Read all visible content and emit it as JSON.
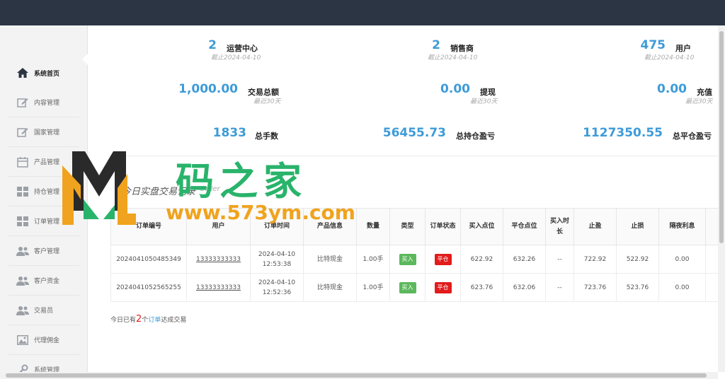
{
  "sidebar": {
    "items": [
      {
        "label": "系统首页",
        "icon": "home-icon",
        "active": true
      },
      {
        "label": "内容管理",
        "icon": "edit-icon"
      },
      {
        "label": "国家管理",
        "icon": "edit-icon"
      },
      {
        "label": "产品管理",
        "icon": "calendar-icon"
      },
      {
        "label": "持仓管理",
        "icon": "grid-icon"
      },
      {
        "label": "订单管理",
        "icon": "grid-icon"
      },
      {
        "label": "客户管理",
        "icon": "users-icon"
      },
      {
        "label": "客户资金",
        "icon": "users-icon"
      },
      {
        "label": "交易员",
        "icon": "users-icon"
      },
      {
        "label": "代理佣金",
        "icon": "image-icon"
      },
      {
        "label": "系统管理",
        "icon": "wrench-icon"
      }
    ]
  },
  "stats": {
    "ops_center": {
      "value": "2",
      "label": "运营中心",
      "sub": "截止2024-04-10"
    },
    "dealers": {
      "value": "2",
      "label": "销售商",
      "sub": "截止2024-04-10"
    },
    "users": {
      "value": "475",
      "label": "用户",
      "sub": "截止2024-04-10"
    },
    "trade_total": {
      "value": "1,000.00",
      "label": "交易总额",
      "sub": "最近30天"
    },
    "withdraw": {
      "value": "0.00",
      "label": "提现",
      "sub": "最近30天"
    },
    "recharge": {
      "value": "0.00",
      "label": "充值",
      "sub": "最近30天"
    },
    "total_lots": {
      "value": "1833",
      "label": "总手数"
    },
    "hold_pnl": {
      "value": "56455.73",
      "label": "总持仓盈亏"
    },
    "close_pnl": {
      "value": "1127350.55",
      "label": "总平仓盈亏"
    }
  },
  "section": {
    "title": "今日实盘交易记录",
    "subtitle": "Order"
  },
  "table": {
    "headers": [
      "订单编号",
      "用户",
      "订单时间",
      "产品信息",
      "数量",
      "类型",
      "订单状态",
      "买入点位",
      "平仓点位",
      "买入时长",
      "止盈",
      "止损",
      "隔夜利息"
    ],
    "rows": [
      {
        "id": "2024041050485349",
        "user": "13333333333",
        "date": "2024-04-10",
        "time": "12:53:38",
        "product": "比特现金",
        "qty": "1.00手",
        "type": "买入",
        "status": "平仓",
        "buy": "622.92",
        "close": "632.26",
        "duration": "--",
        "tp": "722.92",
        "sl": "522.92",
        "interest": "0.00"
      },
      {
        "id": "2024041052565255",
        "user": "13333333333",
        "date": "2024-04-10",
        "time": "12:52:36",
        "product": "比特现金",
        "qty": "1.00手",
        "type": "买入",
        "status": "平仓",
        "buy": "623.76",
        "close": "632.06",
        "duration": "--",
        "tp": "723.76",
        "sl": "523.76",
        "interest": "0.00"
      }
    ]
  },
  "footer": {
    "prefix": "今日已有",
    "count": "2",
    "mid": "个",
    "link": "订单",
    "suffix": "达成交易"
  },
  "watermark": {
    "title": "码之家",
    "url": "www.573ym.com"
  },
  "colors": {
    "accent": "#3d9bd8",
    "topbar": "#2b3543",
    "danger": "#e21b1b",
    "success": "#5cb85c",
    "watermark_green": "#29b36b",
    "watermark_orange": "#f0a31e"
  }
}
